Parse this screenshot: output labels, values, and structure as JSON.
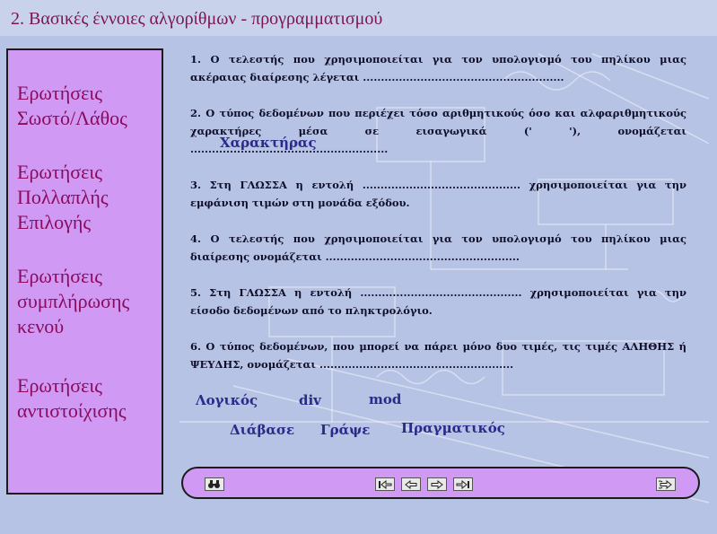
{
  "title": "2. Βασικές έννοιες αλγορίθμων - προγραμματισμού",
  "sidebar": {
    "items": [
      {
        "line1": "Ερωτήσεις",
        "line2": "Σωστό/Λάθος",
        "line3": ""
      },
      {
        "line1": "Ερωτήσεις",
        "line2": "Πολλαπλής",
        "line3": "Επιλογής"
      },
      {
        "line1": "Ερωτήσεις",
        "line2": "συμπλήρωσης",
        "line3": "κενού"
      },
      {
        "line1": "Ερωτήσεις",
        "line2": "αντιστοίχισης",
        "line3": ""
      }
    ]
  },
  "questions": [
    {
      "line1": "1. Ο τελεστής που χρησιμοποιείται για τον υπολογισμό του πηλίκου μιας",
      "line2": "ακέραιας διαίρεσης λέγεται ........................................................"
    },
    {
      "line1": "2. Ο τύπος δεδομένων που περιέχει τόσο αριθμητικούς όσο και αλφαριθμητικούς",
      "line2": "χαρακτήρες μέσα σε εισαγωγικά (' '), ονομάζεται",
      "line3": "......................................................."
    },
    {
      "line1": "3. Στη ΓΛΩΣΣΑ η εντολή ............................................ χρησιμοποιείται για την",
      "line2": "εμφάνιση τιμών στη μονάδα εξόδου."
    },
    {
      "line1": "4. Ο τελεστής που χρησιμοποιείται για τον υπολογισμό του πηλίκου μιας",
      "line2": "διαίρεσης ονομάζεται ......................................................"
    },
    {
      "line1": "5. Στη ΓΛΩΣΣΑ η εντολή ............................................. χρησιμοποιείται για την",
      "line2": "είσοδο δεδομένων από το πληκτρολόγιο."
    },
    {
      "line1": "6. Ο τύπος δεδομένων, που μπορεί να πάρει μόνο δυο τιμές, τις τιμές ΑΛΗΘΗΣ ή",
      "line2": "ΨΕΥΔΗΣ, ονομάζεται ......................................................"
    }
  ],
  "placed_answer": "Χαρακτήρας",
  "answers": [
    "Λογικός",
    "div",
    "mod",
    "Διάβασε",
    "Γράψε",
    "Πραγματικός"
  ],
  "toolbar": {
    "icons": [
      "binoculars-icon",
      "first-icon",
      "prev-icon",
      "next-icon",
      "last-icon",
      "exit-icon"
    ]
  },
  "colors": {
    "background": "#b7c3e4",
    "panel": "#d09af4",
    "title": "#7a1555",
    "sidebar_text": "#8a0b5e",
    "answer_text": "#2a2a8a"
  }
}
